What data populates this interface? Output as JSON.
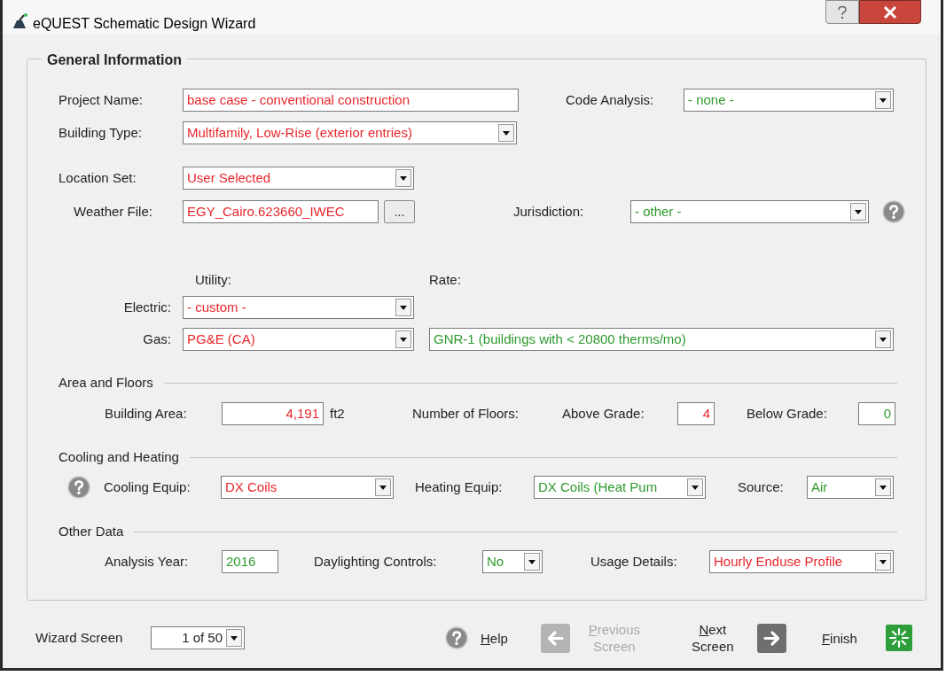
{
  "window": {
    "title": "eQUEST Schematic Design Wizard"
  },
  "group": {
    "title": "General Information"
  },
  "project_name": {
    "label": "Project Name:",
    "value": "base case - conventional construction",
    "modified": true
  },
  "code_analysis": {
    "label": "Code Analysis:",
    "value": "- none -",
    "modified": false
  },
  "building_type": {
    "label": "Building Type:",
    "value": "Multifamily, Low-Rise (exterior entries)",
    "modified": true
  },
  "location_set": {
    "label": "Location Set:",
    "value": "User Selected",
    "modified": true
  },
  "weather_file": {
    "label": "Weather File:",
    "value": "EGY_Cairo.623660_IWEC",
    "modified": true,
    "browse": "..."
  },
  "jurisdiction": {
    "label": "Jurisdiction:",
    "value": "- other -",
    "modified": false
  },
  "utilities": {
    "utility_heading": "Utility:",
    "rate_heading": "Rate:",
    "electric": {
      "label": "Electric:",
      "value": "- custom -",
      "modified": true
    },
    "gas": {
      "label": "Gas:",
      "value": "PG&E (CA)",
      "modified": true
    },
    "gas_rate": {
      "value": "GNR-1 (buildings with < 20800 therms/mo)",
      "modified": false
    }
  },
  "area_and_floors": {
    "title": "Area and Floors",
    "building_area": {
      "label": "Building Area:",
      "value": "4,191",
      "unit": "ft2",
      "modified": true
    },
    "floors_label": "Number of Floors:",
    "above_grade": {
      "label": "Above Grade:",
      "value": "4",
      "modified": true
    },
    "below_grade": {
      "label": "Below Grade:",
      "value": "0",
      "modified": false
    }
  },
  "cooling_and_heating": {
    "title": "Cooling and Heating",
    "cooling_equip": {
      "label": "Cooling Equip:",
      "value": "DX Coils",
      "modified": true
    },
    "heating_equip": {
      "label": "Heating Equip:",
      "value": "DX Coils (Heat Pum",
      "modified": false
    },
    "source": {
      "label": "Source:",
      "value": "Air",
      "modified": false
    }
  },
  "other_data": {
    "title": "Other Data",
    "analysis_year": {
      "label": "Analysis Year:",
      "value": "2016",
      "modified": false
    },
    "daylighting_controls": {
      "label": "Daylighting Controls:",
      "value": "No",
      "modified": false
    },
    "usage_details": {
      "label": "Usage Details:",
      "value": "Hourly Enduse Profile",
      "modified": true
    }
  },
  "footer": {
    "wizard_screen": {
      "label": "Wizard Screen",
      "value": "1 of 50"
    },
    "buttons": [
      {
        "kind": "help",
        "label": "Help",
        "disabled": false
      },
      {
        "kind": "previous",
        "label": "Previous Screen",
        "disabled": true
      },
      {
        "kind": "next",
        "label": "Next Screen",
        "disabled": false
      },
      {
        "kind": "finish",
        "label": "Finish",
        "disabled": false
      }
    ]
  }
}
